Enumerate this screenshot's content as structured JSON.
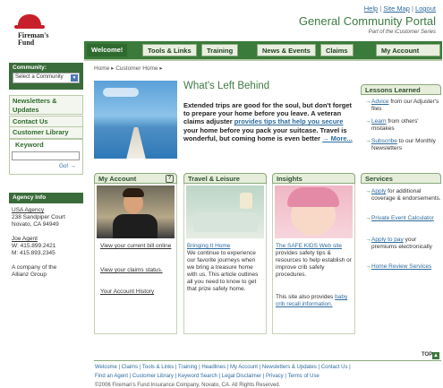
{
  "header": {
    "logo_text": "Fireman's Fund",
    "top_links": [
      "Help",
      "Site Map",
      "Logout"
    ],
    "portal_title": "General Community Portal",
    "portal_subtitle": "Part of the iCustomer Series"
  },
  "tabs": [
    {
      "label": "Welcome!",
      "active": true
    },
    {
      "label": "Tools & Links",
      "active": false
    },
    {
      "label": "Training",
      "active": false
    },
    {
      "label": "News & Events",
      "active": false
    },
    {
      "label": "Claims",
      "active": false
    },
    {
      "label": "My Account",
      "active": false
    }
  ],
  "sidebar": {
    "community_label": "Community:",
    "community_value": "Select a Community",
    "nav": [
      "Newsletters & Updates",
      "Contact Us",
      "Customer Library"
    ],
    "keyword_label": "Keyword",
    "go_label": "Go! →",
    "agency_title": "Agency Info",
    "agency_lines": [
      "USA Agency",
      "238 Sandpiper Court",
      "Novato, CA 94949",
      "",
      "Joe Agent",
      "W: 415.899.2421",
      "M: 415.893.2345",
      "",
      "A company of the",
      "Allianz Group"
    ]
  },
  "breadcrumb": "Home  ▸  Customer Home  ▸",
  "hero": {
    "title": "What's Left Behind",
    "text_1": "Extended trips are good for the soul, but don't forget to prepare your home before you leave. A veteran claims adjuster ",
    "link": "provides tips that help you secure",
    "text_2": " your home before you pack your suitcase. Travel is wonderful, but coming home is even better",
    "more": "→ More..."
  },
  "lessons": {
    "title": "Lessons Learned",
    "items": [
      {
        "link": "Advice",
        "text": " from our Adjuster's files"
      },
      {
        "link": "Learn",
        "text": " from others' mistakes"
      },
      {
        "link": "Subscribe",
        "text": " to our Monthly Newsletters"
      }
    ]
  },
  "my_account": {
    "title": "My Account",
    "help": "?",
    "links": [
      "View your current bill online",
      "View your claims status.",
      "Your Account History"
    ]
  },
  "travel": {
    "title": "Travel & Leisure",
    "link": "Bringing It Home",
    "text": "We continue to experience our favorite journeys when we bring a treasure home with us. This article outlines all you need to know to get that prize safely home."
  },
  "insights": {
    "title": "Insights",
    "link": "The SAFE KIDS Web site",
    "text": " provides safety tips & resources to help establish or improve crib safety procedures.",
    "text2": "This site also provides ",
    "link2": "baby crib recall information."
  },
  "services": {
    "title": "Services",
    "items": [
      {
        "link": "Apply",
        "text": " for additional coverage & endorsements."
      },
      {
        "link": "Private Event Calculator",
        "text": ""
      },
      {
        "link": "Apply to pay",
        "text": " your premiums electronically"
      },
      {
        "link": "Home Review Services",
        "text": ""
      }
    ]
  },
  "footer": {
    "top": "TOP",
    "row1": "Welcome | Claims | Tools & Links | Training | Headlines | My Account | Newsletters & Updates | Contact Us |",
    "row2": "Find an Agent | Customer Library | Keyword Search | Legal Disclaimer | Privacy | Terms of Use",
    "copyright": "©2006 Fireman's Fund Insurance Company, Novato, CA. All Rights Reserved."
  },
  "colors": {
    "brand_green": "#3a7a3a",
    "link_blue": "#2e6b9e",
    "logo_red": "#c8202a"
  }
}
